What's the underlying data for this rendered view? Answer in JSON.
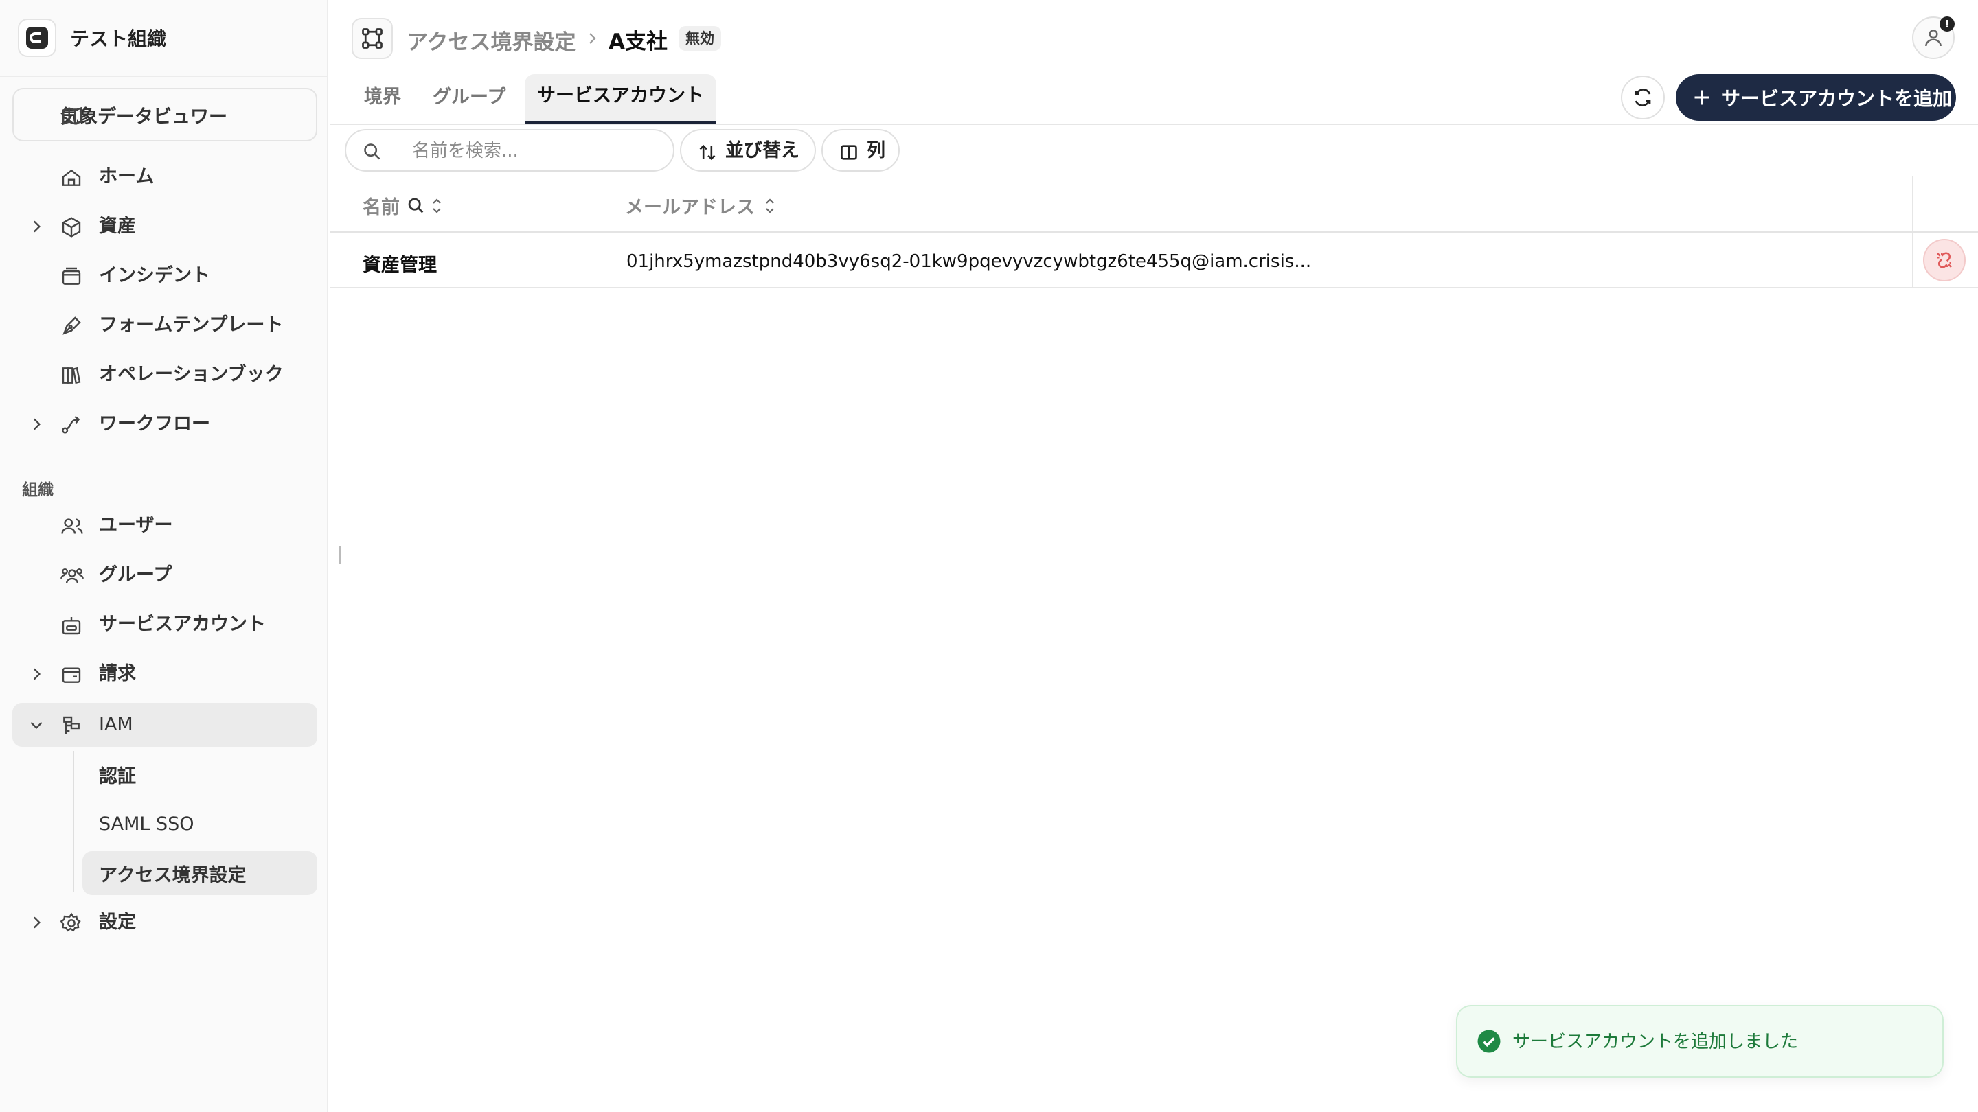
{
  "org": {
    "name": "テスト組織"
  },
  "sidebar": {
    "weather_label": "気象データビュワー",
    "items": [
      {
        "label": "ホーム"
      },
      {
        "label": "資産"
      },
      {
        "label": "インシデント"
      },
      {
        "label": "フォームテンプレート"
      },
      {
        "label": "オペレーションブック"
      },
      {
        "label": "ワークフロー"
      }
    ],
    "section_org": "組織",
    "org_items": [
      {
        "label": "ユーザー"
      },
      {
        "label": "グループ"
      },
      {
        "label": "サービスアカウント"
      },
      {
        "label": "請求"
      },
      {
        "label": "IAM"
      }
    ],
    "iam_sub": [
      {
        "label": "認証"
      },
      {
        "label": "SAML SSO"
      },
      {
        "label": "アクセス境界設定"
      }
    ],
    "settings_label": "設定"
  },
  "header": {
    "breadcrumb_parent": "アクセス境界設定",
    "breadcrumb_current": "A支社",
    "status_badge": "無効",
    "notification_mark": "!"
  },
  "tabs": [
    {
      "label": "境界"
    },
    {
      "label": "グループ"
    },
    {
      "label": "サービスアカウント"
    }
  ],
  "actions": {
    "add_label": "サービスアカウントを追加"
  },
  "toolbar": {
    "search_placeholder": "名前を検索...",
    "sort_label": "並び替え",
    "columns_label": "列"
  },
  "table": {
    "columns": [
      "名前",
      "メールアドレス"
    ],
    "rows": [
      {
        "name": "資産管理",
        "email": "01jhrx5ymazstpnd40b3vy6sq2-01kw9pqevyvzcywbtgz6te455q@iam.crisis..."
      }
    ]
  },
  "toast": {
    "message": "サービスアカウントを追加しました"
  },
  "colors": {
    "primary": "#1e2a44",
    "success": "#1d7a3a",
    "danger": "#e05a5a"
  }
}
